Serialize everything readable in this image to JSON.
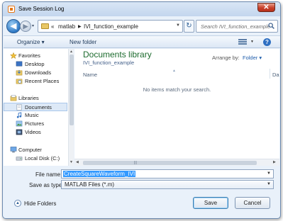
{
  "window": {
    "title": "Save Session Log",
    "close_glyph": "✕"
  },
  "nav": {
    "back_glyph": "◀",
    "forward_glyph": "▶",
    "breadcrumb_prefix": "«",
    "breadcrumb": [
      "matlab",
      "IVI_function_example"
    ],
    "separator": "▶",
    "refresh_glyph": "↻",
    "search_placeholder": "Search IVI_function_example"
  },
  "toolbar": {
    "organize_label": "Organize ▾",
    "new_folder_label": "New folder",
    "help_glyph": "?"
  },
  "sidebar": {
    "favorites": "Favorites",
    "desktop": "Desktop",
    "downloads": "Downloads",
    "recent": "Recent Places",
    "libraries": "Libraries",
    "documents": "Documents",
    "music": "Music",
    "pictures": "Pictures",
    "videos": "Videos",
    "computer": "Computer",
    "local_disk": "Local Disk (C:)"
  },
  "content": {
    "library_title": "Documents library",
    "library_subtitle": "IVI_function_example",
    "arrange_label": "Arrange by:",
    "arrange_value": "Folder ▾",
    "column_name": "Name",
    "column_next": "Da",
    "empty_message": "No items match your search."
  },
  "form": {
    "file_name_label": "File name:",
    "file_name_value": "CreateSquareWaveform_IVI",
    "save_type_label": "Save as type:",
    "save_type_value": "MATLAB Files (*.m)"
  },
  "footer": {
    "hide_folders_label": "Hide Folders",
    "save_label": "Save",
    "cancel_label": "Cancel"
  }
}
